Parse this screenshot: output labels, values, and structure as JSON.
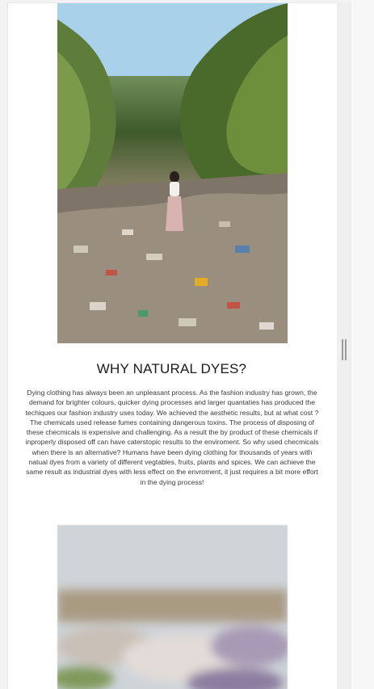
{
  "article": {
    "heading": "WHY NATURAL DYES?",
    "paragraph": "Dying clothing has always been an unpleasant process. As the fashion industry has grown, the demand for brighter colours, quicker dying processes and larger quantaties has produced the techiques our fashion industry uses today. We achieved the aesthetic results, but at what cost ? The chemicals used release fumes containing dangerous toxins. The process of disposing of these checmicals is expensive and challenging. As a result the by product of these chemicals if inproperly disposed off can have caterstopic results to the enviroment. So why used checmicals when there is an alternative? Humans have been dying clothing for thousands of years with natual dyes from a variety of different vegtables, fruits, plants and spices. We can achieve the same result as industrial dyes with less effect on the envroment, it just requires a bit more effort in the dying process!"
  },
  "images": {
    "top": "photo of woman standing on littered path among trees",
    "bottom": "blurred photo of colourful textiles"
  },
  "icons": {
    "resize_handle": "grip-vertical-icon"
  }
}
